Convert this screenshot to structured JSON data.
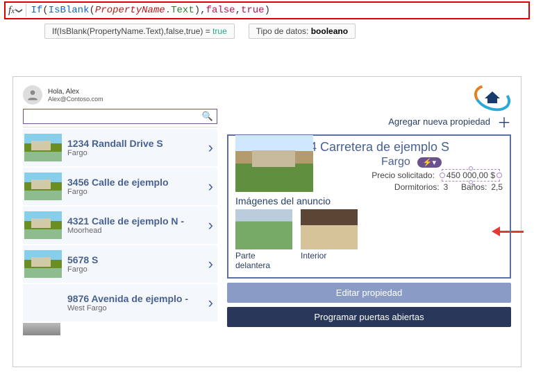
{
  "formula": {
    "fn_if": "If",
    "open1": "(",
    "fn_blank": "IsBlank",
    "open2": "(",
    "prop_name": "PropertyName",
    "dot_text": ".Text",
    "close2": ")",
    "comma1": ",",
    "bool_false": "false",
    "comma2": ",",
    "bool_true": "true",
    "close1": ")"
  },
  "result_bar": {
    "expr": "If(IsBlank(PropertyName.Text),false,true)  =",
    "eq_val": " true",
    "type_label": "Tipo de datos: ",
    "type_value": "booleano"
  },
  "user": {
    "greeting": "Hola, Alex",
    "email": "Alex@Contoso.com"
  },
  "search": {
    "placeholder": ""
  },
  "add_label": "Agregar nueva propiedad",
  "list": [
    {
      "title": "1234 Randall Drive S",
      "city": "Fargo"
    },
    {
      "title": "3456 Calle de ejemplo",
      "city": "Fargo"
    },
    {
      "title": "4321 Calle de ejemplo N -",
      "city": "Moorhead"
    },
    {
      "title": "5678 S",
      "city": "Fargo"
    },
    {
      "title": "9876 Avenida de ejemplo -",
      "city": "West Fargo"
    }
  ],
  "detail": {
    "title": "1234 Carretera de ejemplo S",
    "city": "Fargo",
    "badge": "⚡▾",
    "price_label": "Precio solicitado:",
    "price_value": "450 000,00 $",
    "beds_label": "Dormitorios:",
    "beds_value": "3",
    "baths_label": "Baños:",
    "baths_value": "2,5",
    "gallery_label": "Imágenes del anuncio",
    "captions": {
      "front": "Parte delantera",
      "interior": "Interior"
    }
  },
  "buttons": {
    "edit": "Editar propiedad",
    "schedule": "Programar puertas abiertas"
  }
}
